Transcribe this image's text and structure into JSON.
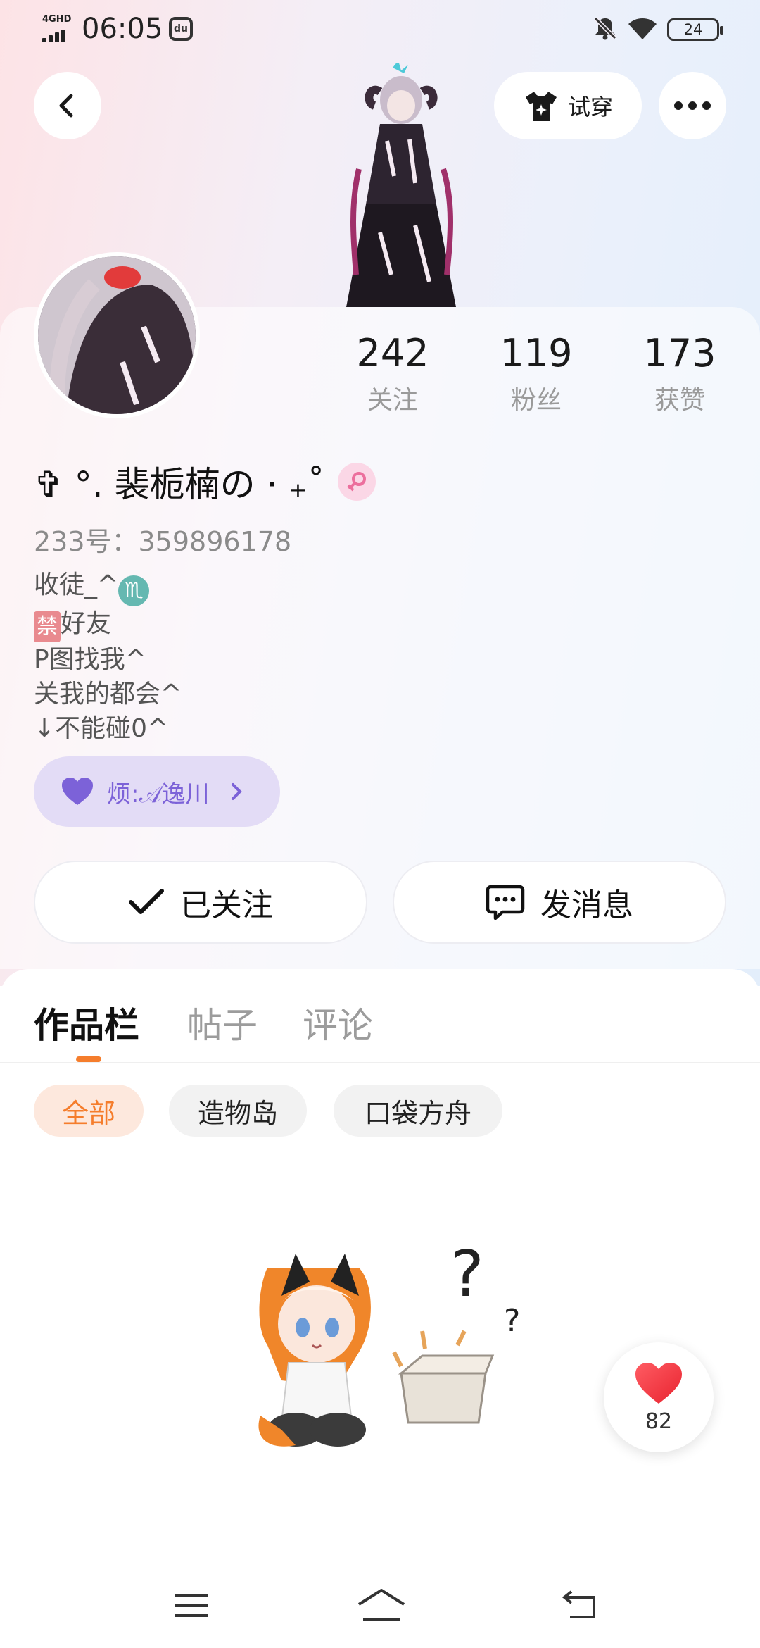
{
  "status_bar": {
    "network": "4GHD",
    "time": "06:05",
    "app_icon_glyph": "du",
    "battery": "24"
  },
  "top_actions": {
    "try_on_label": "试穿"
  },
  "stats": [
    {
      "value": "242",
      "label": "关注"
    },
    {
      "value": "119",
      "label": "粉丝"
    },
    {
      "value": "173",
      "label": "获赞"
    }
  ],
  "profile": {
    "nickname": "✞ °. 裴栀楠の · ₊˚",
    "uid_label": "233号：",
    "uid_value": "359896178",
    "bio": {
      "line1_text": "收徒_^",
      "line1_badge": "♏",
      "line2_badge": "禁",
      "line2_text": "好友",
      "line3": "P图找我^",
      "line4": "关我的都会^",
      "line5": "↓不能碰0^"
    },
    "cp_label": "烦:𝒜逸川",
    "cp_color": "#7c62d8"
  },
  "actions": {
    "follow_label": "已关注",
    "message_label": "发消息"
  },
  "tabs": [
    {
      "label": "作品栏",
      "active": true
    },
    {
      "label": "帖子",
      "active": false
    },
    {
      "label": "评论",
      "active": false
    }
  ],
  "filters": [
    {
      "label": "全部",
      "active": true
    },
    {
      "label": "造物岛",
      "active": false
    },
    {
      "label": "口袋方舟",
      "active": false
    }
  ],
  "like_fab": {
    "count": "82"
  },
  "colors": {
    "accent": "#f57d2c",
    "heart": "#f0414e",
    "cp_chip_bg": "#e3dcf6"
  },
  "icons": {
    "back": "chevron-left-icon",
    "more": "more-horizontal-icon",
    "try_on": "tshirt-icon",
    "gender": "female-icon",
    "heart": "heart-icon",
    "check": "check-icon",
    "message": "chat-bubble-icon"
  }
}
